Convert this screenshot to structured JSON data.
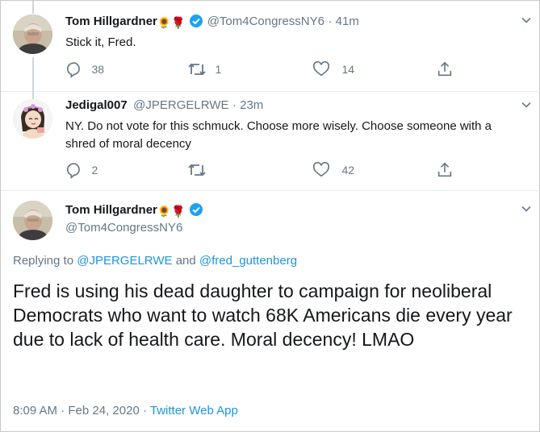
{
  "tweet1": {
    "name": "Tom Hillgardner",
    "handle": "@Tom4CongressNY6",
    "time": "41m",
    "text": "Stick it, Fred.",
    "replies": "38",
    "retweets": "1",
    "likes": "14"
  },
  "tweet2": {
    "name": "Jedigal007",
    "handle": "@JPERGELRWE",
    "time": "23m",
    "text": "NY. Do not vote for this schmuck. Choose more wisely. Choose someone with a shred of moral decency",
    "replies": "2",
    "retweets": "",
    "likes": "42"
  },
  "main_tweet": {
    "name": "Tom Hillgardner",
    "handle": "@Tom4CongressNY6",
    "replying_prefix": "Replying to",
    "replying_user1": "@JPERGELRWE",
    "replying_and": "and",
    "replying_user2": "@fred_guttenberg",
    "text": "Fred is using his dead daughter to campaign for neoliberal Democrats who want to watch 68K Americans die every year due to lack of health care. Moral decency! LMAO",
    "time": "8:09 AM",
    "date": "Feb 24, 2020",
    "source": "Twitter Web App"
  },
  "emoji": {
    "sunflower": "🌻",
    "rose": "🌹"
  },
  "colors": {
    "link": "#1b95e0",
    "secondary": "#657786",
    "verified": "#1da1f2"
  }
}
